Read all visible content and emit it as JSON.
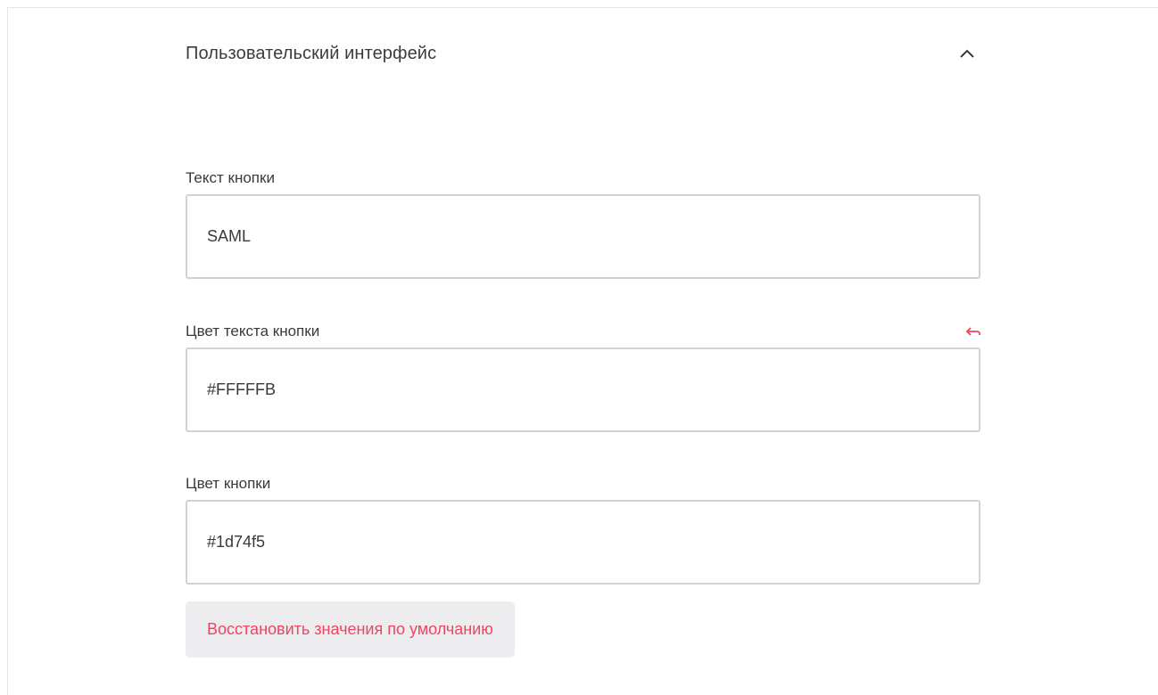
{
  "section": {
    "title": "Пользовательский интерфейс",
    "collapse_icon": "chevron-up-icon"
  },
  "fields": [
    {
      "label": "Текст кнопки",
      "value": "SAML"
    },
    {
      "label": "Цвет текста кнопки",
      "value": "#FFFFFB",
      "reset_icon": "undo-arrow-icon"
    },
    {
      "label": "Цвет кнопки",
      "value": "#1d74f5"
    }
  ],
  "restore_button": {
    "label": "Восстановить значения по умолчанию"
  },
  "colors": {
    "accent": "#f0445f",
    "input_border": "#d2d2d2",
    "button_bg": "#ededf0",
    "text": "#3a3a3a"
  }
}
